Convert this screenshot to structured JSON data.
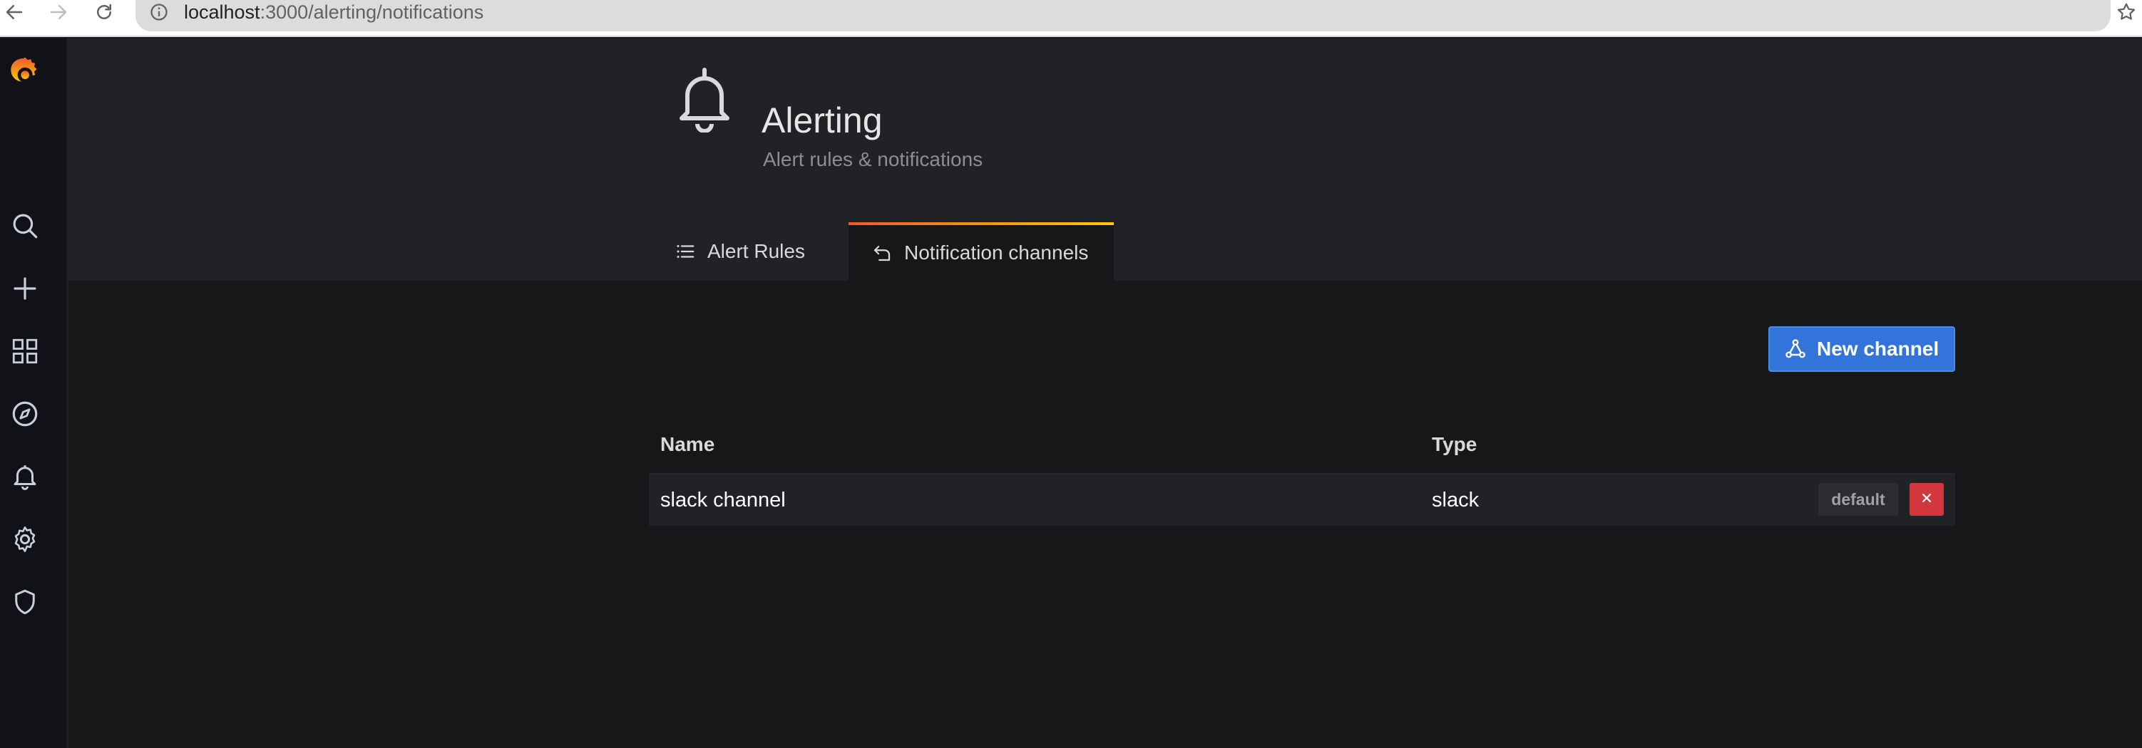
{
  "browser": {
    "url_host": "localhost",
    "url_path": ":3000/alerting/notifications"
  },
  "sidebar": {
    "items": [
      {
        "name": "search",
        "icon": "search-icon"
      },
      {
        "name": "create",
        "icon": "plus-icon"
      },
      {
        "name": "dashboards",
        "icon": "dashboards-icon"
      },
      {
        "name": "explore",
        "icon": "compass-icon"
      },
      {
        "name": "alerting",
        "icon": "bell-icon"
      },
      {
        "name": "configuration",
        "icon": "gear-icon"
      },
      {
        "name": "server-admin",
        "icon": "shield-icon"
      }
    ]
  },
  "header": {
    "title": "Alerting",
    "subtitle": "Alert rules & notifications",
    "tabs": [
      {
        "label": "Alert Rules",
        "icon": "list-icon",
        "active": false
      },
      {
        "label": "Notification channels",
        "icon": "notification-channel-icon",
        "active": true
      }
    ]
  },
  "actions": {
    "new_channel_label": "New channel"
  },
  "table": {
    "columns": [
      "Name",
      "Type"
    ],
    "rows": [
      {
        "name": "slack channel",
        "type": "slack",
        "badge": "default"
      }
    ]
  },
  "colors": {
    "primary": "#3274d9",
    "danger": "#d1373d",
    "tab_accent_start": "#f05a28",
    "tab_accent_end": "#fbca0a",
    "background": "#161719",
    "header_bg": "#202226"
  }
}
